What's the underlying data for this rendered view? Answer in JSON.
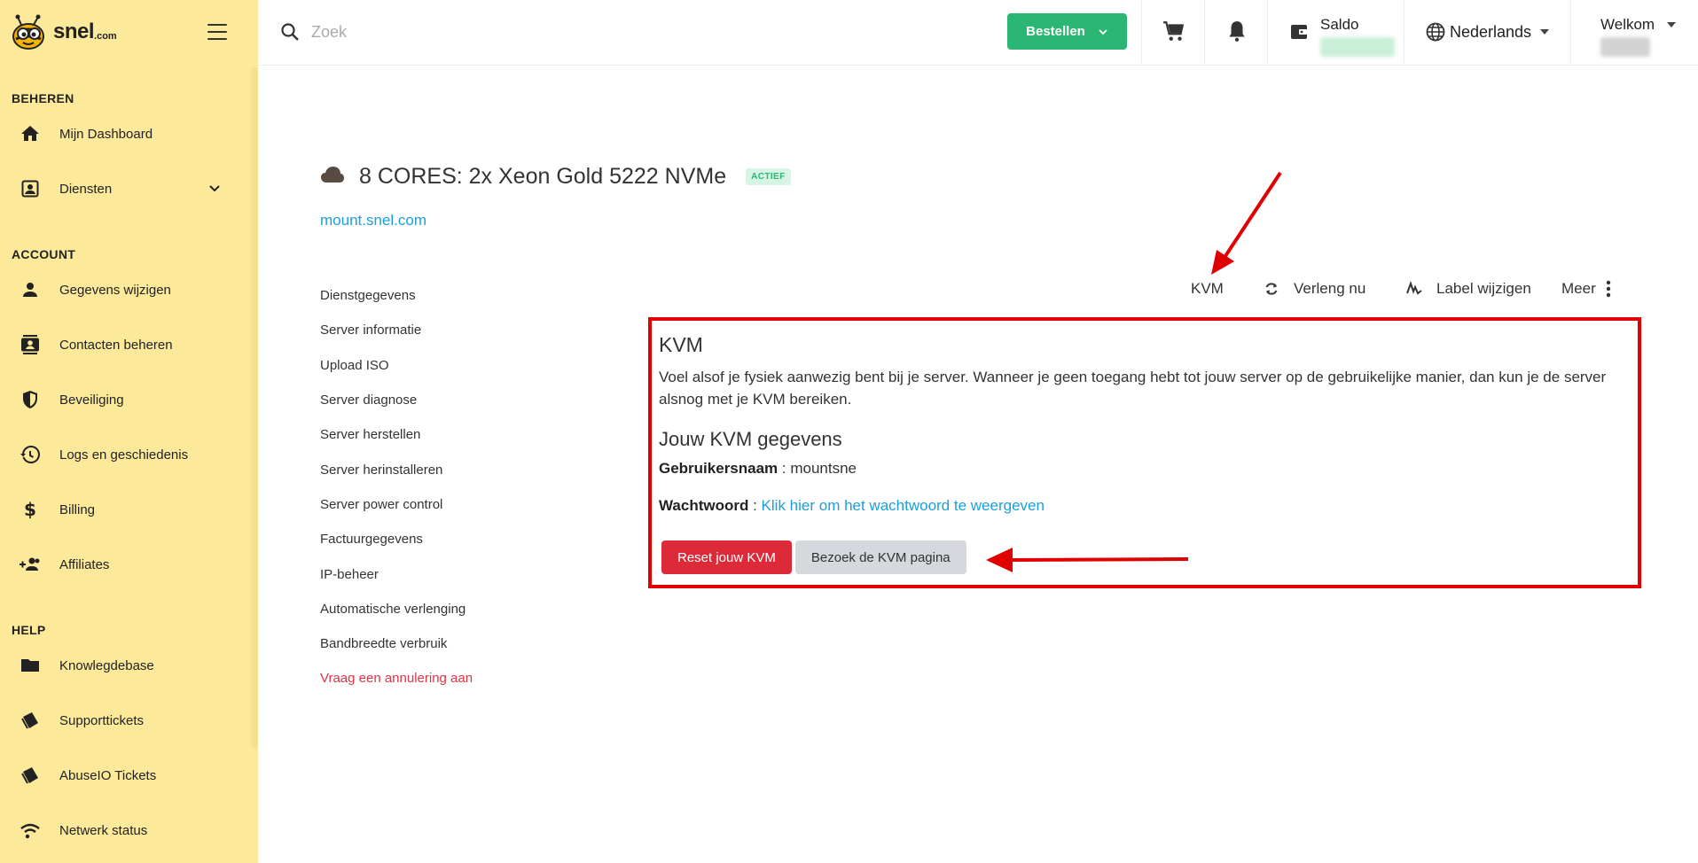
{
  "brand": {
    "name": "snel",
    "suffix": ".com"
  },
  "sidebar": {
    "sections": [
      {
        "title": "BEHEREN"
      },
      {
        "title": "ACCOUNT"
      },
      {
        "title": "HELP"
      }
    ],
    "items": [
      {
        "label": "Mijn Dashboard",
        "icon": "home-icon"
      },
      {
        "label": "Diensten",
        "icon": "contact-card-icon"
      },
      {
        "label": "Gegevens wijzigen",
        "icon": "person-icon"
      },
      {
        "label": "Contacten beheren",
        "icon": "contacts-icon"
      },
      {
        "label": "Beveiliging",
        "icon": "shield-icon"
      },
      {
        "label": "Logs en geschiedenis",
        "icon": "history-icon"
      },
      {
        "label": "Billing",
        "icon": "dollar-icon"
      },
      {
        "label": "Affiliates",
        "icon": "group-add-icon"
      },
      {
        "label": "Knowlegdebase",
        "icon": "folder-icon"
      },
      {
        "label": "Supporttickets",
        "icon": "ticket-icon"
      },
      {
        "label": "AbuseIO Tickets",
        "icon": "ticket-icon"
      },
      {
        "label": "Netwerk status",
        "icon": "wifi-icon"
      }
    ]
  },
  "topbar": {
    "search_placeholder": "Zoek",
    "order_label": "Bestellen",
    "saldo_label": "Saldo",
    "language": "Nederlands",
    "welcome_label": "Welkom"
  },
  "service": {
    "title": "8 CORES: 2x Xeon Gold 5222 NVMe",
    "status": "ACTIEF",
    "domain": "mount.snel.com"
  },
  "sub_nav": [
    "Dienstgegevens",
    "Server informatie",
    "Upload ISO",
    "Server diagnose",
    "Server herstellen",
    "Server herinstalleren",
    "Server power control",
    "Factuurgegevens",
    "IP-beheer",
    "Automatische verlenging",
    "Bandbreedte verbruik",
    "Vraag een annulering aan"
  ],
  "actions": {
    "kvm": "KVM",
    "renew": "Verleng nu",
    "label": "Label wijzigen",
    "more": "Meer"
  },
  "kvm": {
    "title": "KVM",
    "description": "Voel alsof je fysiek aanwezig bent bij je server. Wanneer je geen toegang hebt tot jouw server op de gebruikelijke manier, dan kun je de server alsnog met je KVM bereiken.",
    "subtitle": "Jouw KVM gegevens",
    "username_label": "Gebruikersnaam",
    "username": "mountsne",
    "password_label": "Wachtwoord",
    "password_link": "Klik hier om het wachtwoord te weergeven",
    "reset_button": "Reset jouw KVM",
    "visit_button": "Bezoek de KVM pagina"
  },
  "colors": {
    "sidebar_bg": "#fde99a",
    "order_green": "#2bb673",
    "link_blue": "#1a9fd9",
    "danger_red": "#dc2a38",
    "annotation_red": "#e00000"
  }
}
